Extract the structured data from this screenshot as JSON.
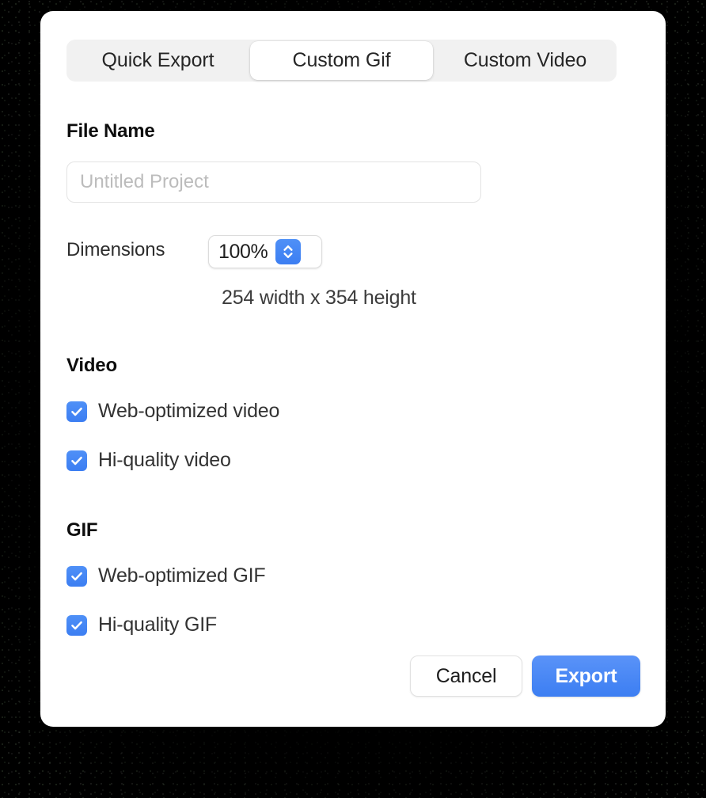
{
  "dialog": {
    "tabs": [
      {
        "label": "Quick Export",
        "selected": false
      },
      {
        "label": "Custom Gif",
        "selected": true
      },
      {
        "label": "Custom Video",
        "selected": false
      }
    ],
    "file_name": {
      "label": "File Name",
      "value": "",
      "placeholder": "Untitled Project"
    },
    "dimensions": {
      "label": "Dimensions",
      "scale_value": "100%",
      "readout": "254 width x 354 height",
      "stepper_icon": "chevron-up-down-icon"
    },
    "sections": [
      {
        "title": "Video",
        "options": [
          {
            "label": "Web-optimized video",
            "checked": true
          },
          {
            "label": "Hi-quality video",
            "checked": true
          }
        ]
      },
      {
        "title": "GIF",
        "options": [
          {
            "label": "Web-optimized GIF",
            "checked": true
          },
          {
            "label": "Hi-quality GIF",
            "checked": true
          }
        ]
      }
    ],
    "footer": {
      "cancel_label": "Cancel",
      "export_label": "Export"
    },
    "colors": {
      "accent_blue": "#3c7ef2",
      "accent_blue_light": "#5a93f8",
      "tabbar_track": "#f1f1f1",
      "dialog_background": "#ffffff",
      "backdrop": "#000000",
      "border_gray": "#e3e3e3",
      "placeholder_gray": "#bcbcbc",
      "text_primary": "#0d0d0d",
      "text_secondary": "#333333"
    }
  }
}
